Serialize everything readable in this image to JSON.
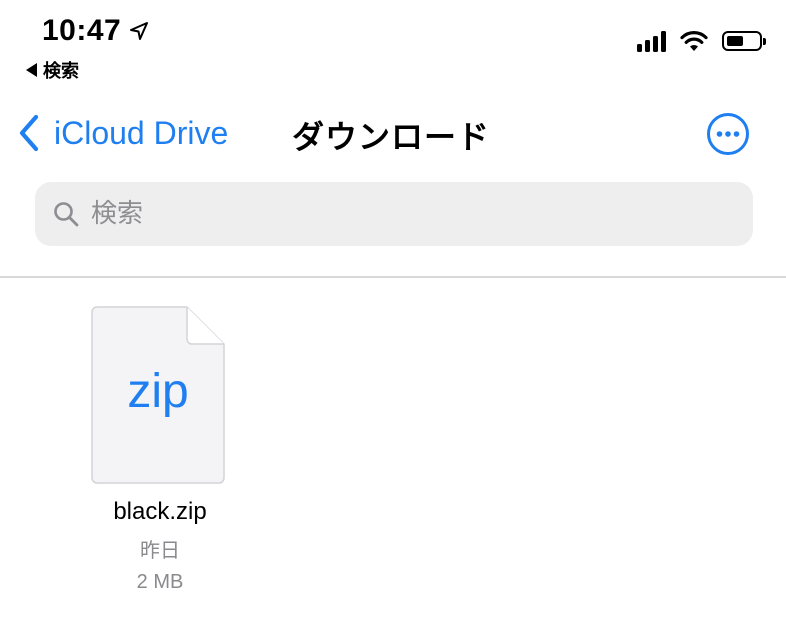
{
  "status_bar": {
    "time": "10:47",
    "back_app_label": "検索"
  },
  "nav": {
    "back_label": "iCloud Drive",
    "title": "ダウンロード"
  },
  "search": {
    "placeholder": "検索",
    "value": ""
  },
  "files": [
    {
      "extension": "zip",
      "name": "black.zip",
      "date": "昨日",
      "size": "2 MB"
    }
  ],
  "colors": {
    "accent": "#1f7ff1",
    "secondary_text": "#8a8a8e",
    "search_bg": "#eeeeef"
  }
}
